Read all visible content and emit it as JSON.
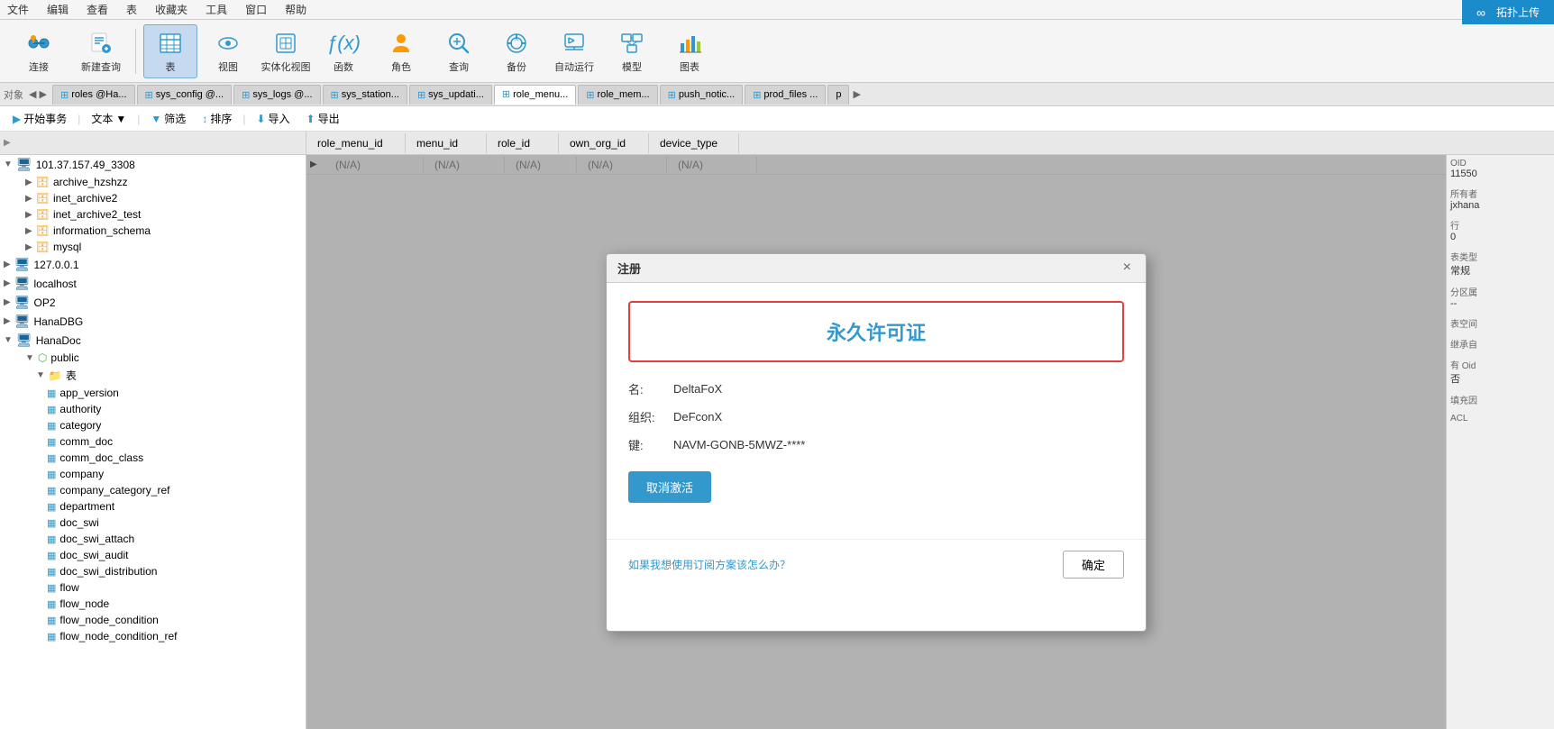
{
  "menu": {
    "items": [
      "文件",
      "编辑",
      "查看",
      "表",
      "收藏夹",
      "工具",
      "窗口",
      "帮助"
    ]
  },
  "toolbar": {
    "buttons": [
      {
        "id": "connect",
        "label": "连接",
        "icon": "🔗"
      },
      {
        "id": "new-query",
        "label": "新建查询",
        "icon": "📝"
      },
      {
        "id": "table",
        "label": "表",
        "icon": "⊞",
        "active": true
      },
      {
        "id": "view",
        "label": "视图",
        "icon": "👁"
      },
      {
        "id": "materialized-view",
        "label": "实体化视图",
        "icon": "⊟"
      },
      {
        "id": "function",
        "label": "函数",
        "icon": "ƒ"
      },
      {
        "id": "role",
        "label": "角色",
        "icon": "👤"
      },
      {
        "id": "query",
        "label": "查询",
        "icon": "🔍"
      },
      {
        "id": "backup",
        "label": "备份",
        "icon": "💾"
      },
      {
        "id": "autorun",
        "label": "自动运行",
        "icon": "▶"
      },
      {
        "id": "model",
        "label": "模型",
        "icon": "🗂"
      },
      {
        "id": "chart",
        "label": "图表",
        "icon": "📊"
      }
    ]
  },
  "tabs": [
    {
      "id": "roles",
      "label": "roles @Ha...",
      "active": false
    },
    {
      "id": "sys_config",
      "label": "sys_config @...",
      "active": false
    },
    {
      "id": "sys_logs",
      "label": "sys_logs @...",
      "active": false
    },
    {
      "id": "sys_station",
      "label": "sys_station...",
      "active": false
    },
    {
      "id": "sys_updati",
      "label": "sys_updati...",
      "active": false
    },
    {
      "id": "role_menu",
      "label": "role_menu...",
      "active": true
    },
    {
      "id": "role_mem",
      "label": "role_mem...",
      "active": false
    },
    {
      "id": "push_notic",
      "label": "push_notic...",
      "active": false
    },
    {
      "id": "prod_files",
      "label": "prod_files ...",
      "active": false
    },
    {
      "id": "p",
      "label": "p",
      "active": false
    }
  ],
  "action_bar": {
    "buttons": [
      "开始事务",
      "文本",
      "筛选",
      "排序",
      "导入",
      "导出"
    ]
  },
  "columns": [
    "role_menu_id",
    "menu_id",
    "role_id",
    "own_org_id",
    "device_type"
  ],
  "data_row": {
    "arrow": "▶",
    "cells": [
      "(N/A)",
      "(N/A)",
      "(N/A)",
      "(N/A)",
      "(N/A)"
    ]
  },
  "sidebar": {
    "server1": {
      "label": "101.37.157.49_3308",
      "icon": "server"
    },
    "databases": [
      {
        "id": "archive_hzshzz",
        "label": "archive_hzshzz",
        "expanded": false
      },
      {
        "id": "inet_archive2",
        "label": "inet_archive2",
        "expanded": false
      },
      {
        "id": "inet_archive2_test",
        "label": "inet_archive2_test",
        "expanded": false
      },
      {
        "id": "information_schema",
        "label": "information_schema",
        "expanded": false
      },
      {
        "id": "mysql",
        "label": "mysql",
        "expanded": false
      }
    ],
    "server2": {
      "label": "127.0.0.1",
      "icon": "server"
    },
    "server3": {
      "label": "localhost",
      "icon": "server"
    },
    "server4": {
      "label": "OP2",
      "icon": "server",
      "expanded": false
    },
    "server5": {
      "label": "HanaDBG",
      "icon": "server"
    },
    "server6": {
      "label": "HanaDoc",
      "icon": "server",
      "expanded": true,
      "children": {
        "public": {
          "label": "public",
          "expanded": true,
          "tables": {
            "label": "表",
            "expanded": true,
            "items": [
              "app_version",
              "authority",
              "category",
              "comm_doc",
              "comm_doc_class",
              "company",
              "company_category_ref",
              "department",
              "doc_swi",
              "doc_swi_attach",
              "doc_swi_audit",
              "doc_swi_distribution",
              "flow",
              "flow_node",
              "flow_node_condition",
              "flow_node_condition_ref"
            ]
          }
        }
      }
    }
  },
  "right_panel": {
    "properties": [
      {
        "label": "OID",
        "value": "11550"
      },
      {
        "label": "所有者",
        "value": "jxhana"
      },
      {
        "label": "行",
        "value": "0"
      },
      {
        "label": "表类型",
        "value": "常规"
      },
      {
        "label": "分区属",
        "value": "--"
      },
      {
        "label": "表空间",
        "value": ""
      },
      {
        "label": "继承自",
        "value": ""
      },
      {
        "label": "有 Oid",
        "value": "否"
      },
      {
        "label": "填充因",
        "value": ""
      },
      {
        "label": "ACL",
        "value": ""
      }
    ]
  },
  "dialog": {
    "title": "注册",
    "close_label": "×",
    "license_text": "永久许可证",
    "fields": [
      {
        "label": "名:",
        "value": "DeltaFoX"
      },
      {
        "label": "组织:",
        "value": "DeFconX"
      },
      {
        "label": "键:",
        "value": "NAVM-GONB-5MWZ-****"
      }
    ],
    "deactivate_btn": "取消激活",
    "subscription_link": "如果我想使用订阅方案该怎么办？",
    "ok_btn": "确定"
  },
  "upload_btn": "拓扑上传",
  "nav_arrow": "◀▶"
}
